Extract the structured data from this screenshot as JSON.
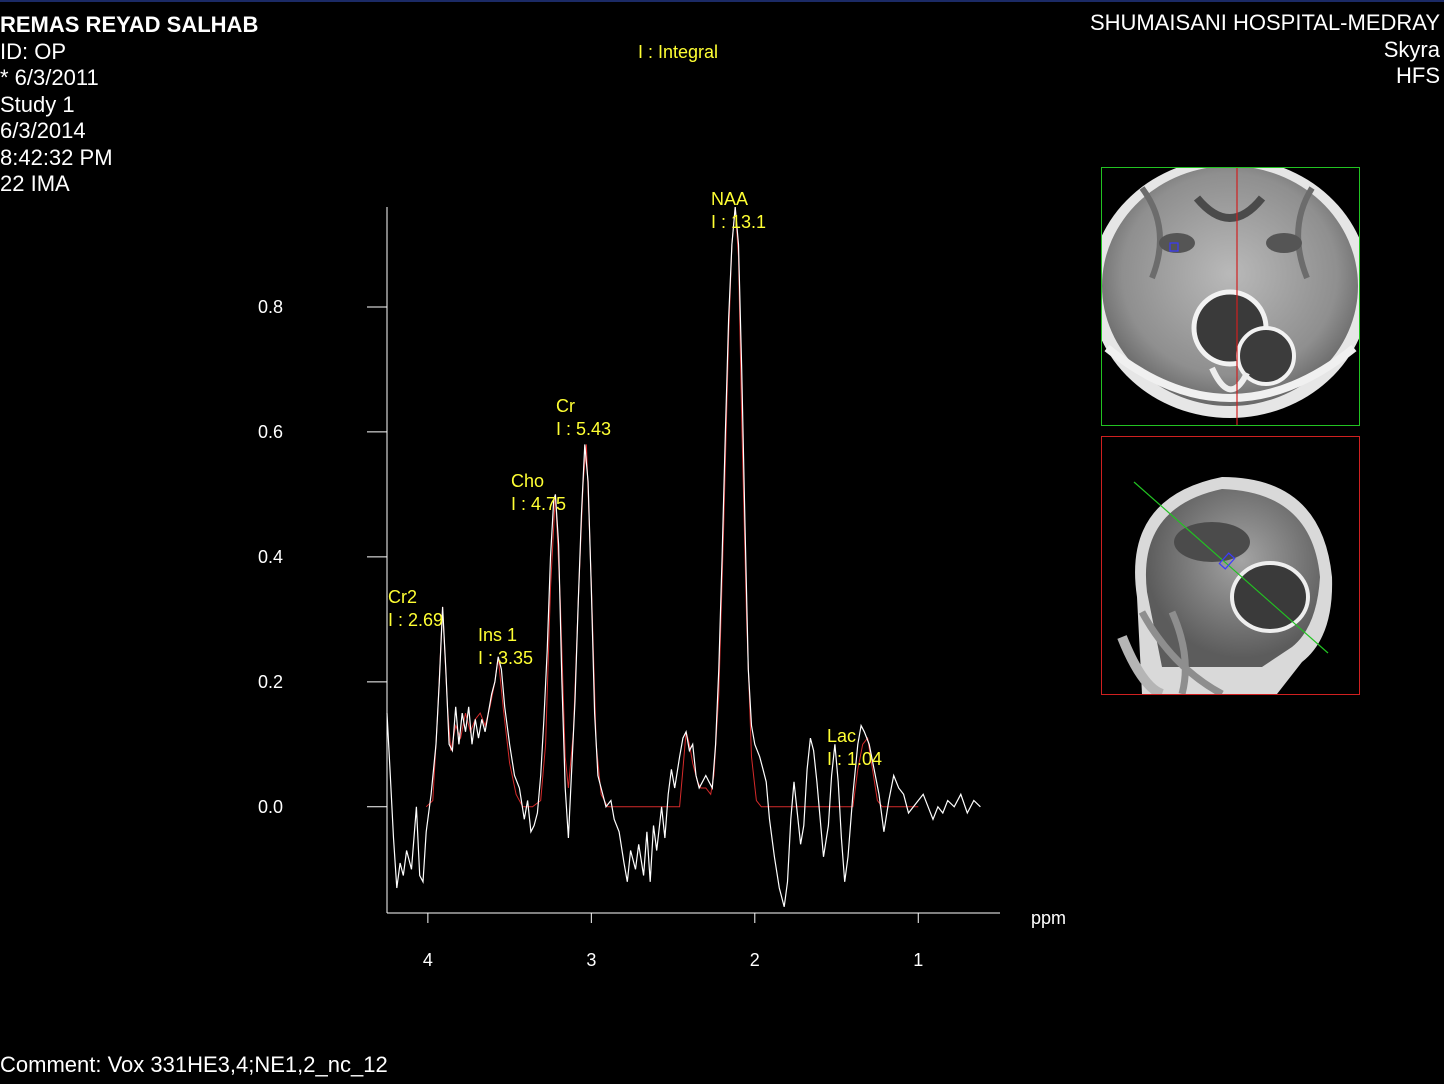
{
  "patient": {
    "name": "REMAS REYAD SALHAB",
    "id": "ID: OP",
    "birth_date": "* 6/3/2011",
    "study": "Study 1",
    "study_date": "6/3/2014",
    "study_time": "8:42:32 PM",
    "image": "22 IMA"
  },
  "site": {
    "hospital": "SHUMAISANI HOSPITAL-MEDRAY",
    "scanner": "Skyra",
    "position": "HFS"
  },
  "legend_note": "I : Integral",
  "comment": "Comment: Vox 331HE3,4;NE1,2_nc_12",
  "colors": {
    "background": "#000000",
    "spectrum": "#ffffff",
    "fit": "#d42a2a",
    "annotation": "#ffff33",
    "axial_frame": "#22c322",
    "sagittal_frame": "#d02020",
    "voxel": "#3a3aff"
  },
  "chart_data": {
    "type": "line",
    "xlabel": "ppm",
    "ylabel": "",
    "x_reversed": true,
    "xlim": [
      0.5,
      4.25
    ],
    "ylim": [
      -0.17,
      0.96
    ],
    "x_ticks": [
      "4",
      "3",
      "2",
      "1"
    ],
    "y_ticks": [
      "0.0",
      "0.2",
      "0.4",
      "0.6",
      "0.8"
    ],
    "peaks": [
      {
        "name": "Cr2",
        "integral": "I : 2.69",
        "ppm": 3.91,
        "height": 0.32
      },
      {
        "name": "Ins 1",
        "integral": "I : 3.35",
        "ppm": 3.56,
        "height": 0.24
      },
      {
        "name": "Cho",
        "integral": "I : 4.75",
        "ppm": 3.22,
        "height": 0.5
      },
      {
        "name": "Cr",
        "integral": "I : 5.43",
        "ppm": 3.03,
        "height": 0.58
      },
      {
        "name": "NAA",
        "integral": "I : 13.1",
        "ppm": 2.01,
        "height": 0.96
      },
      {
        "name": "Lac",
        "integral": "I : 1.04",
        "ppm": 1.3,
        "height": 0.11
      }
    ],
    "series": [
      {
        "kind": "measured spectrum",
        "points": [
          [
            4.25,
            0.15
          ],
          [
            4.23,
            0.05
          ],
          [
            4.21,
            -0.05
          ],
          [
            4.19,
            -0.13
          ],
          [
            4.17,
            -0.09
          ],
          [
            4.15,
            -0.11
          ],
          [
            4.13,
            -0.07
          ],
          [
            4.1,
            -0.1
          ],
          [
            4.07,
            0.0
          ],
          [
            4.05,
            -0.11
          ],
          [
            4.03,
            -0.12
          ],
          [
            4.01,
            -0.04
          ],
          [
            3.98,
            0.02
          ],
          [
            3.95,
            0.1
          ],
          [
            3.93,
            0.2
          ],
          [
            3.91,
            0.32
          ],
          [
            3.89,
            0.22
          ],
          [
            3.87,
            0.1
          ],
          [
            3.85,
            0.09
          ],
          [
            3.83,
            0.16
          ],
          [
            3.81,
            0.1
          ],
          [
            3.79,
            0.15
          ],
          [
            3.77,
            0.12
          ],
          [
            3.75,
            0.16
          ],
          [
            3.73,
            0.1
          ],
          [
            3.71,
            0.14
          ],
          [
            3.69,
            0.11
          ],
          [
            3.67,
            0.14
          ],
          [
            3.65,
            0.12
          ],
          [
            3.63,
            0.15
          ],
          [
            3.61,
            0.18
          ],
          [
            3.59,
            0.2
          ],
          [
            3.57,
            0.24
          ],
          [
            3.55,
            0.22
          ],
          [
            3.53,
            0.16
          ],
          [
            3.5,
            0.1
          ],
          [
            3.47,
            0.05
          ],
          [
            3.44,
            0.03
          ],
          [
            3.41,
            -0.02
          ],
          [
            3.39,
            0.01
          ],
          [
            3.37,
            -0.04
          ],
          [
            3.35,
            -0.03
          ],
          [
            3.33,
            -0.01
          ],
          [
            3.31,
            0.05
          ],
          [
            3.29,
            0.14
          ],
          [
            3.27,
            0.25
          ],
          [
            3.25,
            0.4
          ],
          [
            3.23,
            0.49
          ],
          [
            3.22,
            0.5
          ],
          [
            3.2,
            0.42
          ],
          [
            3.18,
            0.2
          ],
          [
            3.16,
            0.03
          ],
          [
            3.14,
            -0.05
          ],
          [
            3.12,
            0.06
          ],
          [
            3.1,
            0.17
          ],
          [
            3.08,
            0.33
          ],
          [
            3.06,
            0.47
          ],
          [
            3.04,
            0.58
          ],
          [
            3.02,
            0.52
          ],
          [
            3.0,
            0.35
          ],
          [
            2.98,
            0.15
          ],
          [
            2.96,
            0.05
          ],
          [
            2.94,
            0.03
          ],
          [
            2.91,
            0.0
          ],
          [
            2.88,
            0.01
          ],
          [
            2.86,
            -0.02
          ],
          [
            2.83,
            -0.04
          ],
          [
            2.8,
            -0.09
          ],
          [
            2.78,
            -0.12
          ],
          [
            2.76,
            -0.07
          ],
          [
            2.73,
            -0.1
          ],
          [
            2.71,
            -0.06
          ],
          [
            2.68,
            -0.11
          ],
          [
            2.66,
            -0.04
          ],
          [
            2.64,
            -0.12
          ],
          [
            2.62,
            -0.03
          ],
          [
            2.6,
            -0.07
          ],
          [
            2.57,
            0.0
          ],
          [
            2.55,
            -0.05
          ],
          [
            2.53,
            0.02
          ],
          [
            2.51,
            0.06
          ],
          [
            2.49,
            0.03
          ],
          [
            2.46,
            0.08
          ],
          [
            2.44,
            0.11
          ],
          [
            2.42,
            0.12
          ],
          [
            2.4,
            0.09
          ],
          [
            2.38,
            0.1
          ],
          [
            2.36,
            0.05
          ],
          [
            2.34,
            0.03
          ],
          [
            2.32,
            0.04
          ],
          [
            2.3,
            0.05
          ],
          [
            2.28,
            0.04
          ],
          [
            2.26,
            0.03
          ],
          [
            2.24,
            0.1
          ],
          [
            2.22,
            0.22
          ],
          [
            2.2,
            0.4
          ],
          [
            2.18,
            0.6
          ],
          [
            2.16,
            0.78
          ],
          [
            2.14,
            0.9
          ],
          [
            2.12,
            0.96
          ],
          [
            2.1,
            0.9
          ],
          [
            2.08,
            0.7
          ],
          [
            2.06,
            0.45
          ],
          [
            2.04,
            0.22
          ],
          [
            2.02,
            0.13
          ],
          [
            2.0,
            0.1
          ],
          [
            1.97,
            0.08
          ],
          [
            1.95,
            0.06
          ],
          [
            1.93,
            0.04
          ],
          [
            1.91,
            -0.02
          ],
          [
            1.88,
            -0.08
          ],
          [
            1.85,
            -0.13
          ],
          [
            1.82,
            -0.16
          ],
          [
            1.8,
            -0.12
          ],
          [
            1.78,
            -0.02
          ],
          [
            1.76,
            0.04
          ],
          [
            1.74,
            -0.01
          ],
          [
            1.72,
            -0.06
          ],
          [
            1.7,
            -0.03
          ],
          [
            1.68,
            0.06
          ],
          [
            1.66,
            0.11
          ],
          [
            1.64,
            0.09
          ],
          [
            1.62,
            0.04
          ],
          [
            1.6,
            -0.02
          ],
          [
            1.58,
            -0.08
          ],
          [
            1.55,
            -0.03
          ],
          [
            1.53,
            0.05
          ],
          [
            1.51,
            0.1
          ],
          [
            1.49,
            0.04
          ],
          [
            1.47,
            -0.05
          ],
          [
            1.45,
            -0.12
          ],
          [
            1.43,
            -0.08
          ],
          [
            1.4,
            0.02
          ],
          [
            1.37,
            0.1
          ],
          [
            1.35,
            0.13
          ],
          [
            1.33,
            0.12
          ],
          [
            1.3,
            0.1
          ],
          [
            1.27,
            0.06
          ],
          [
            1.24,
            0.02
          ],
          [
            1.21,
            -0.04
          ],
          [
            1.18,
            0.01
          ],
          [
            1.15,
            0.05
          ],
          [
            1.12,
            0.03
          ],
          [
            1.09,
            0.02
          ],
          [
            1.06,
            -0.01
          ],
          [
            1.03,
            0.0
          ],
          [
            1.0,
            0.01
          ],
          [
            0.97,
            0.02
          ],
          [
            0.94,
            0.0
          ],
          [
            0.91,
            -0.02
          ],
          [
            0.88,
            0.0
          ],
          [
            0.85,
            -0.01
          ],
          [
            0.82,
            0.01
          ],
          [
            0.78,
            0.0
          ],
          [
            0.74,
            0.02
          ],
          [
            0.7,
            -0.01
          ],
          [
            0.66,
            0.01
          ],
          [
            0.62,
            0.0
          ]
        ]
      },
      {
        "kind": "model fit",
        "points": [
          [
            4.01,
            0.0
          ],
          [
            3.97,
            0.01
          ],
          [
            3.94,
            0.15
          ],
          [
            3.91,
            0.32
          ],
          [
            3.88,
            0.16
          ],
          [
            3.86,
            0.09
          ],
          [
            3.83,
            0.13
          ],
          [
            3.8,
            0.11
          ],
          [
            3.77,
            0.15
          ],
          [
            3.74,
            0.12
          ],
          [
            3.71,
            0.14
          ],
          [
            3.68,
            0.15
          ],
          [
            3.65,
            0.13
          ],
          [
            3.62,
            0.16
          ],
          [
            3.59,
            0.2
          ],
          [
            3.57,
            0.24
          ],
          [
            3.54,
            0.16
          ],
          [
            3.5,
            0.07
          ],
          [
            3.46,
            0.02
          ],
          [
            3.42,
            0.0
          ],
          [
            3.36,
            0.0
          ],
          [
            3.31,
            0.01
          ],
          [
            3.28,
            0.1
          ],
          [
            3.25,
            0.35
          ],
          [
            3.22,
            0.5
          ],
          [
            3.19,
            0.33
          ],
          [
            3.16,
            0.08
          ],
          [
            3.14,
            0.03
          ],
          [
            3.11,
            0.12
          ],
          [
            3.08,
            0.33
          ],
          [
            3.05,
            0.52
          ],
          [
            3.03,
            0.58
          ],
          [
            3.0,
            0.36
          ],
          [
            2.97,
            0.1
          ],
          [
            2.94,
            0.02
          ],
          [
            2.9,
            0.0
          ],
          [
            2.46,
            0.0
          ],
          [
            2.44,
            0.06
          ],
          [
            2.42,
            0.12
          ],
          [
            2.4,
            0.1
          ],
          [
            2.38,
            0.07
          ],
          [
            2.35,
            0.04
          ],
          [
            2.33,
            0.03
          ],
          [
            2.3,
            0.03
          ],
          [
            2.27,
            0.02
          ],
          [
            2.25,
            0.05
          ],
          [
            2.22,
            0.18
          ],
          [
            2.19,
            0.45
          ],
          [
            2.16,
            0.75
          ],
          [
            2.14,
            0.9
          ],
          [
            2.12,
            0.96
          ],
          [
            2.1,
            0.88
          ],
          [
            2.08,
            0.62
          ],
          [
            2.05,
            0.3
          ],
          [
            2.02,
            0.08
          ],
          [
            1.99,
            0.01
          ],
          [
            1.96,
            0.0
          ],
          [
            1.4,
            0.0
          ],
          [
            1.37,
            0.06
          ],
          [
            1.34,
            0.1
          ],
          [
            1.31,
            0.11
          ],
          [
            1.28,
            0.06
          ],
          [
            1.25,
            0.01
          ],
          [
            1.22,
            0.0
          ],
          [
            1.0,
            0.0
          ]
        ]
      }
    ],
    "grid": false,
    "legend": "none"
  }
}
